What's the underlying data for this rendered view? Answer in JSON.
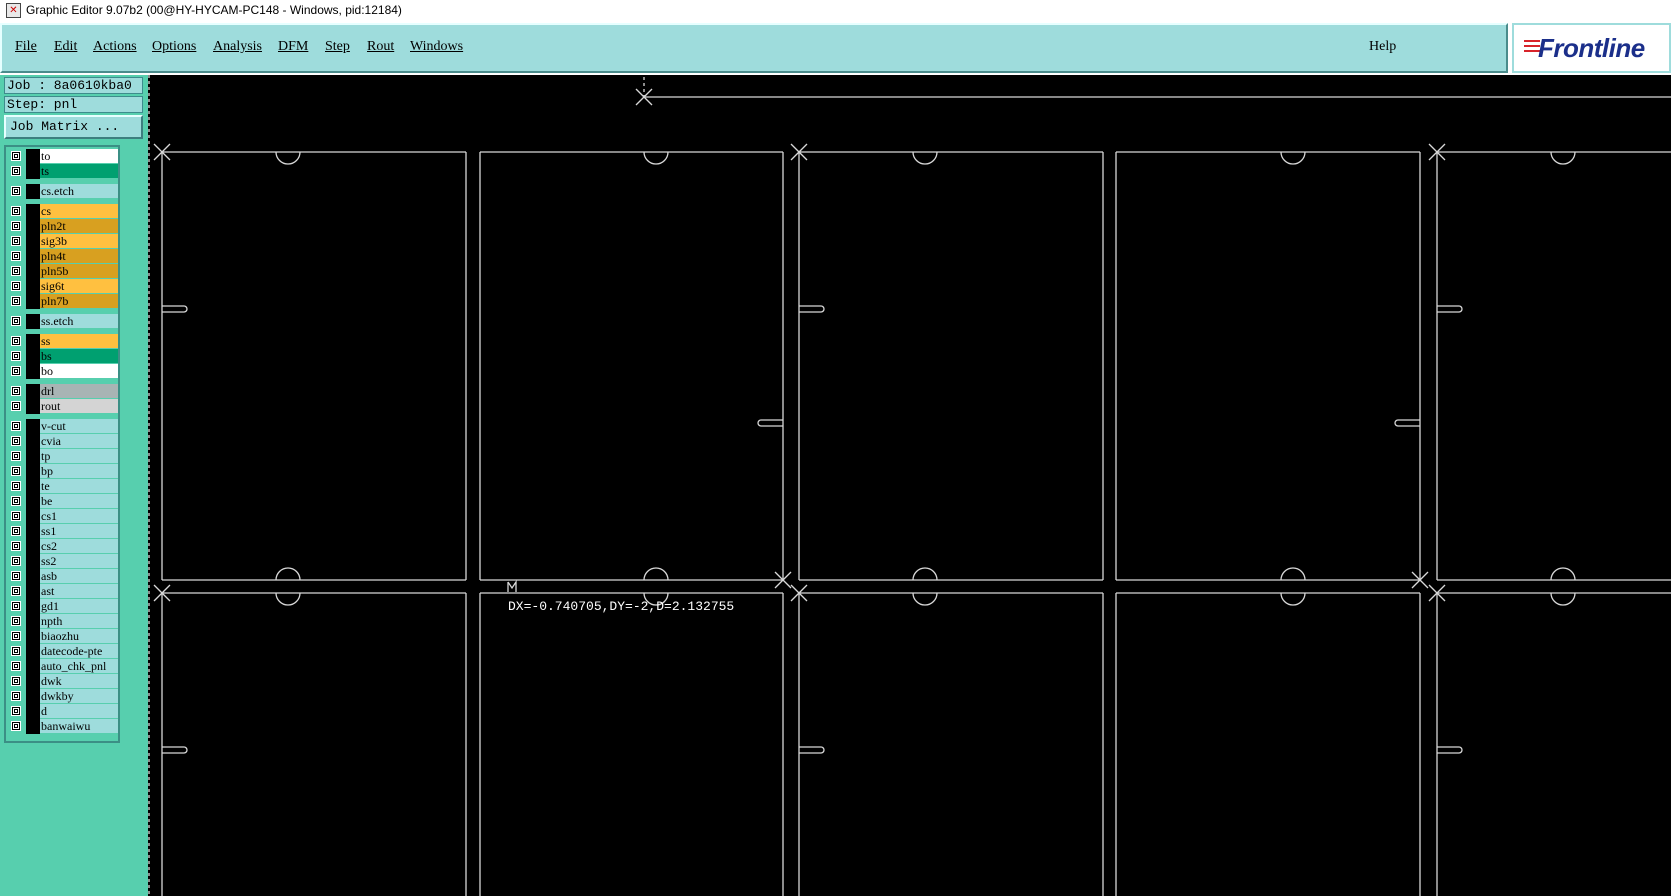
{
  "window": {
    "title": "Graphic Editor 9.07b2 (00@HY-HYCAM-PC148 - Windows, pid:12184)"
  },
  "menubar": {
    "items": [
      {
        "label": "File",
        "name": "menu-file"
      },
      {
        "label": "Edit",
        "name": "menu-edit"
      },
      {
        "label": "Actions",
        "name": "menu-actions"
      },
      {
        "label": "Options",
        "name": "menu-options"
      },
      {
        "label": "Analysis",
        "name": "menu-analysis"
      },
      {
        "label": "DFM",
        "name": "menu-dfm"
      },
      {
        "label": "Step",
        "name": "menu-step"
      },
      {
        "label": "Rout",
        "name": "menu-rout"
      },
      {
        "label": "Windows",
        "name": "menu-windows"
      }
    ],
    "help_label": "Help"
  },
  "logo": {
    "text": "Frontline"
  },
  "left_panel": {
    "job_label": "Job : 8a0610kba0",
    "step_label": "Step: pnl",
    "job_matrix_label": "Job Matrix ..."
  },
  "layers": [
    {
      "name": "to",
      "color": "#ffffff"
    },
    {
      "name": "ts",
      "color": "#00a070"
    },
    {
      "name": "cs.etch",
      "color": "#9edcdc"
    },
    {
      "name": "cs",
      "color": "#ffc040"
    },
    {
      "name": "pln2t",
      "color": "#d8a020"
    },
    {
      "name": "sig3b",
      "color": "#ffc040"
    },
    {
      "name": "pln4t",
      "color": "#d8a020"
    },
    {
      "name": "pln5b",
      "color": "#d8a020"
    },
    {
      "name": "sig6t",
      "color": "#ffc040"
    },
    {
      "name": "pln7b",
      "color": "#d8a020"
    },
    {
      "name": "ss.etch",
      "color": "#9edcdc"
    },
    {
      "name": "ss",
      "color": "#ffc040"
    },
    {
      "name": "bs",
      "color": "#00a070"
    },
    {
      "name": "bo",
      "color": "#ffffff"
    },
    {
      "name": "drl",
      "color": "#a8b4b4"
    },
    {
      "name": "rout",
      "color": "#d4d4d4"
    },
    {
      "name": "v-cut",
      "color": "#9edcdc"
    },
    {
      "name": "cvia",
      "color": "#9edcdc"
    },
    {
      "name": "tp",
      "color": "#9edcdc"
    },
    {
      "name": "bp",
      "color": "#9edcdc"
    },
    {
      "name": "te",
      "color": "#9edcdc"
    },
    {
      "name": "be",
      "color": "#9edcdc"
    },
    {
      "name": "cs1",
      "color": "#9edcdc"
    },
    {
      "name": "ss1",
      "color": "#9edcdc"
    },
    {
      "name": "cs2",
      "color": "#9edcdc"
    },
    {
      "name": "ss2",
      "color": "#9edcdc"
    },
    {
      "name": "asb",
      "color": "#9edcdc"
    },
    {
      "name": "ast",
      "color": "#9edcdc"
    },
    {
      "name": "gd1",
      "color": "#9edcdc"
    },
    {
      "name": "npth",
      "color": "#9edcdc"
    },
    {
      "name": "biaozhu",
      "color": "#9edcdc"
    },
    {
      "name": "datecode-pte",
      "color": "#9edcdc"
    },
    {
      "name": "auto_chk_pnl",
      "color": "#9edcdc"
    },
    {
      "name": "dwk",
      "color": "#9edcdc"
    },
    {
      "name": "dwkby",
      "color": "#9edcdc"
    },
    {
      "name": "d",
      "color": "#9edcdc"
    },
    {
      "name": "banwaiwu",
      "color": "#9edcdc"
    }
  ],
  "canvas": {
    "measure_readout": "DX=-0.740705,DY=-2,D=2.132755"
  }
}
